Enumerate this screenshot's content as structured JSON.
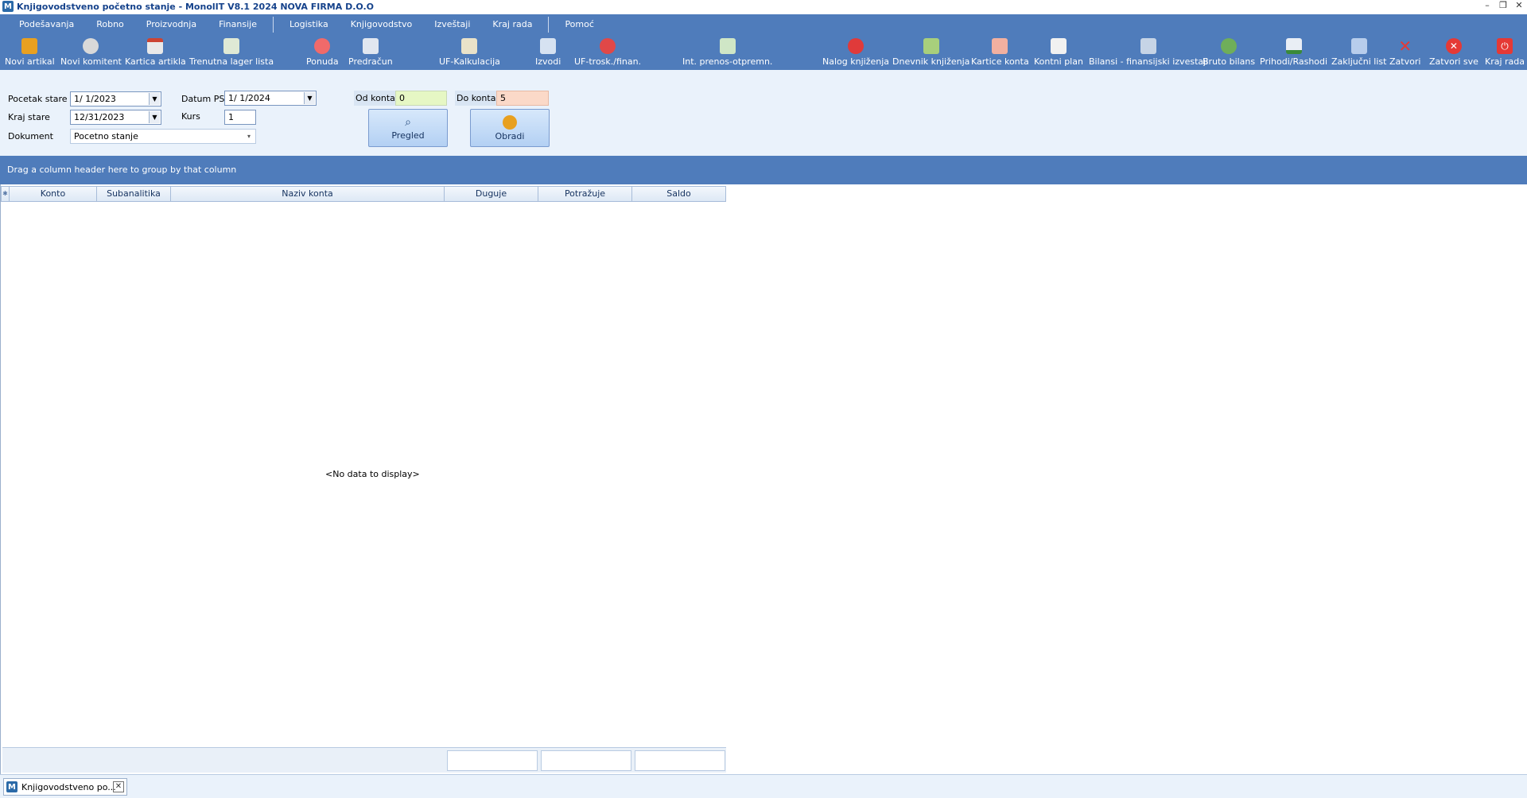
{
  "window": {
    "title": "Knjigovodstveno početno stanje - MonolIT V8.1 2024 NOVA FIRMA D.O.O",
    "app_icon": "M"
  },
  "menu": {
    "items": [
      "Podešavanja",
      "Robno",
      "Proizvodnja",
      "Finansije",
      "Logistika",
      "Knjigovodstvo",
      "Izveštaji",
      "Kraj rada",
      "Pomoć"
    ]
  },
  "toolbar": {
    "items": [
      {
        "label": "Novi artikal",
        "icon": "new-article-icon",
        "color": "#e8a020"
      },
      {
        "label": "Novi komitent",
        "icon": "new-client-icon",
        "color": "#d9d9d9"
      },
      {
        "label": "Kartica artikla",
        "icon": "article-card-icon",
        "color": "#e9e9e9"
      },
      {
        "label": "Trenutna lager lista",
        "icon": "stock-list-icon",
        "color": "#dfe9d5"
      },
      {
        "label": "Ponuda",
        "icon": "offer-icon",
        "color": "#f06a6a"
      },
      {
        "label": "Predračun",
        "icon": "proforma-icon",
        "color": "#e1e7f0"
      },
      {
        "label": "UF-Kalkulacija",
        "icon": "calculation-icon",
        "color": "#e9e2c9"
      },
      {
        "label": "Izvodi",
        "icon": "statements-icon",
        "color": "#d6e2f1"
      },
      {
        "label": "UF-trosk./finan.",
        "icon": "expenses-icon",
        "color": "#e04848"
      },
      {
        "label": "Int. prenos-otpremn.",
        "icon": "internal-transfer-icon",
        "color": "#cfe6c6"
      },
      {
        "label": "Nalog knjiženja",
        "icon": "posting-order-icon",
        "color": "#e03a3a"
      },
      {
        "label": "Dnevnik knjiženja",
        "icon": "journal-icon",
        "color": "#a8cf7c"
      },
      {
        "label": "Kartice konta",
        "icon": "account-cards-icon",
        "color": "#f2b0a0"
      },
      {
        "label": "Kontni plan",
        "icon": "chart-of-accounts-icon",
        "color": "#f1f1f1"
      },
      {
        "label": "Bilansi - finansijski izvestaji",
        "icon": "balance-icon",
        "color": "#c6d4e6"
      },
      {
        "label": "Bruto bilans",
        "icon": "gross-balance-icon",
        "color": "#6fae5a"
      },
      {
        "label": "Prihodi/Rashodi",
        "icon": "income-expense-icon",
        "color": "#e9eef5"
      },
      {
        "label": "Zaključni list",
        "icon": "closing-sheet-icon",
        "color": "#b7cdec"
      },
      {
        "label": "Zatvori",
        "icon": "close-icon",
        "color": "#e53935"
      },
      {
        "label": "Zatvori sve",
        "icon": "close-all-icon",
        "color": "#e53935"
      },
      {
        "label": "Kraj rada",
        "icon": "power-icon",
        "color": "#e53935"
      }
    ]
  },
  "filters": {
    "pocetak_label": "Pocetak stare",
    "pocetak_value": "1/ 1/2023",
    "kraj_label": "Kraj stare",
    "kraj_value": "12/31/2023",
    "dokument_label": "Dokument",
    "dokument_value": "Pocetno stanje",
    "datum_ps_label": "Datum PS",
    "datum_ps_value": "1/ 1/2024",
    "kurs_label": "Kurs",
    "kurs_value": "1",
    "od_konta_label": "Od konta",
    "od_konta_value": "0",
    "do_konta_label": "Do konta",
    "do_konta_value": "5",
    "pregled_label": "Pregled",
    "obradi_label": "Obradi"
  },
  "grid": {
    "group_hint": "Drag a column header here to group by that column",
    "columns": [
      "Konto",
      "Subanalitika",
      "Naziv konta",
      "Duguje",
      "Potražuje",
      "Saldo"
    ],
    "empty_text": "<No data to display>"
  },
  "tabs": {
    "active_tab": "Knjigovodstveno po..."
  },
  "colors": {
    "toolbar_bg": "#4f7cbb",
    "panel_bg": "#eaf2fb"
  }
}
